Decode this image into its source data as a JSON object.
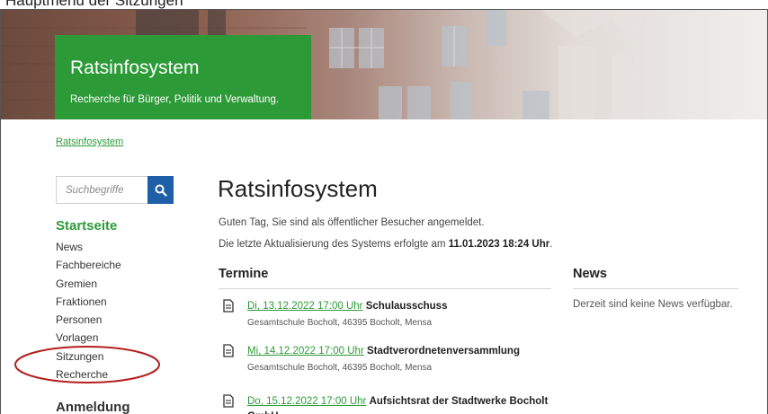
{
  "header": {
    "title": "Ratsinfosystem",
    "subtitle": "Recherche für Bürger, Politik und Verwaltung."
  },
  "top_partial_text": "Hauptmenü der Sitzungen",
  "breadcrumb": "Ratsinfosystem",
  "search": {
    "placeholder": "Suchbegriffe",
    "icon": "search-icon"
  },
  "sidebar": {
    "heading": "Startseite",
    "items": [
      {
        "label": "News"
      },
      {
        "label": "Fachbereiche"
      },
      {
        "label": "Gremien"
      },
      {
        "label": "Fraktionen"
      },
      {
        "label": "Personen"
      },
      {
        "label": "Vorlagen"
      },
      {
        "label": "Sitzungen"
      },
      {
        "label": "Recherche"
      }
    ],
    "section2": "Anmeldung"
  },
  "main": {
    "title": "Ratsinfosystem",
    "greeting": "Guten Tag, Sie sind als öffentlicher Besucher angemeldet.",
    "update_prefix": "Die letzte Aktualisierung des Systems erfolgte am ",
    "update_value": "11.01.2023 18:24 Uhr",
    "update_suffix": "."
  },
  "termine": {
    "heading": "Termine",
    "events": [
      {
        "date": "Di, 13.12.2022 17:00 Uhr",
        "title": "Schulausschuss",
        "location": "Gesamtschule Bocholt, 46395 Bocholt, Mensa"
      },
      {
        "date": "Mi, 14.12.2022 17:00 Uhr",
        "title": "Stadtverordnetenversammlung",
        "location": "Gesamtschule Bocholt, 46395 Bocholt, Mensa"
      },
      {
        "date": "Do, 15.12.2022 17:00 Uhr",
        "title": "Aufsichtsrat der Stadtwerke Bocholt GmbH",
        "location": ""
      }
    ]
  },
  "news": {
    "heading": "News",
    "text": "Derzeit sind keine News verfügbar."
  },
  "colors": {
    "brand_green": "#2d9a38",
    "search_blue": "#1f5fa8",
    "annotation_red": "#b41e1e"
  }
}
